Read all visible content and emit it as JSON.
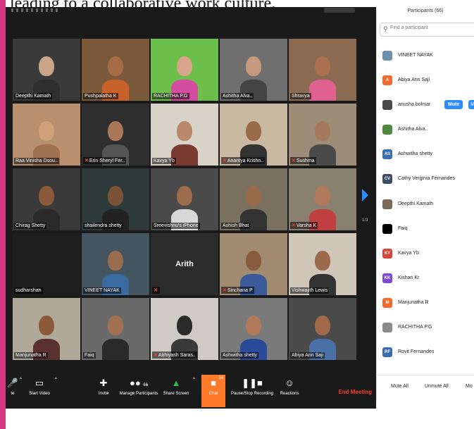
{
  "caption": "leading to a collaborative work culture.",
  "colors": {
    "accent": "#2d8cff",
    "chat": "#ff7a29",
    "end": "#ff3b30",
    "active_speaker": "#e5df5a",
    "pink_bar": "#d6387e"
  },
  "panel": {
    "title": "Participants (66)",
    "search_placeholder": "Find a participant",
    "participants": [
      {
        "name": "VINEET NAYAK",
        "avatar": "",
        "color": "#6d8fb0",
        "muted_button": false
      },
      {
        "name": "Abiya Ann Saji",
        "avatar": "A",
        "color": "#f26a2e",
        "muted_button": false
      },
      {
        "name": "anusha bolmar",
        "avatar": "",
        "color": "#4a4a4a",
        "muted_button": true,
        "mute_label": "Mute",
        "more_label": "M"
      },
      {
        "name": "Ashitha Alva..",
        "avatar": "",
        "color": "#4f8a3c",
        "muted_button": false
      },
      {
        "name": "Ashwitha shetty",
        "avatar": "AS",
        "color": "#3b6db2",
        "muted_button": false
      },
      {
        "name": "Cathy Verginia Fernandes",
        "avatar": "CV",
        "color": "#3e4c66",
        "muted_button": false
      },
      {
        "name": "Deepthi Kamath",
        "avatar": "",
        "color": "#7a6a5a",
        "muted_button": false
      },
      {
        "name": "Faiq",
        "avatar": "",
        "color": "#000000",
        "muted_button": false
      },
      {
        "name": "Kavya Yb",
        "avatar": "KY",
        "color": "#d9443a",
        "muted_button": false
      },
      {
        "name": "Kishan Kr",
        "avatar": "KK",
        "color": "#7b4bd1",
        "muted_button": false
      },
      {
        "name": "Manjunatha R",
        "avatar": "M",
        "color": "#f26a2e",
        "muted_button": false
      },
      {
        "name": "RACHITHA P.G",
        "avatar": "",
        "color": "#8a8a8a",
        "muted_button": false
      },
      {
        "name": "Rovit Fernandes",
        "avatar": "RF",
        "color": "#3b6db2",
        "muted_button": false
      }
    ],
    "mute_all": "Mute All",
    "unmute_all": "Unmute All",
    "more": "Mo"
  },
  "gallery": {
    "page_indicator": "1/3",
    "tiles": [
      {
        "name": "Deepthi Kamath",
        "muted": false,
        "bg": "#3a3a3a",
        "skin": "#c9a58a",
        "shirt": "#2f2f2f"
      },
      {
        "name": "Pushpalatha K",
        "muted": false,
        "bg": "#7a5a3a",
        "skin": "#a66c45",
        "shirt": "#c8612a",
        "active": true
      },
      {
        "name": "RACHITHA P.G",
        "muted": false,
        "bg": "#6cbf4a",
        "skin": "#d9a58a",
        "shirt": "#d54ca0"
      },
      {
        "name": "Ashitha Alva..",
        "muted": false,
        "bg": "#6f6f6f",
        "skin": "#c69a7c",
        "shirt": "#444"
      },
      {
        "name": "Shravya",
        "muted": false,
        "bg": "#8a6a50",
        "skin": "#a8704f",
        "shirt": "#e06090"
      },
      {
        "name": "Raa Vinisha Dsou..",
        "muted": false,
        "bg": "#b89070",
        "skin": "#d0a07a",
        "shirt": "#a07050"
      },
      {
        "name": "Erin Sheryl Fer..",
        "muted": true,
        "bg": "#2e2e2e",
        "skin": "#a87858",
        "shirt": "#555"
      },
      {
        "name": "Kavya Yb",
        "muted": false,
        "bg": "#d8d3c8",
        "skin": "#b9876a",
        "shirt": "#7a3a30"
      },
      {
        "name": "Anantya Krishn..",
        "muted": true,
        "bg": "#c9b9a3",
        "skin": "#9b6a4a",
        "shirt": "#333"
      },
      {
        "name": "Sushma",
        "muted": true,
        "bg": "#9d8d78",
        "skin": "#a57a5c",
        "shirt": "#4a4a4a"
      },
      {
        "name": "Chirag Shetty",
        "muted": false,
        "bg": "#3a3a3a",
        "skin": "#8a5a3a",
        "shirt": "#2a2a2a"
      },
      {
        "name": "shailendra shetty",
        "muted": false,
        "bg": "#2f3a3a",
        "skin": "#7a5236",
        "shirt": "#222"
      },
      {
        "name": "Sreevishnu's iPhone",
        "muted": false,
        "bg": "#4a4a4a",
        "skin": "#9c6c4c",
        "shirt": "#d8d8d8"
      },
      {
        "name": "Ashish Bhat",
        "muted": false,
        "bg": "#7a7060",
        "skin": "#9a6a48",
        "shirt": "#333"
      },
      {
        "name": "Varsha K",
        "muted": true,
        "bg": "#8a8070",
        "skin": "#b07a5a",
        "shirt": "#c04040"
      },
      {
        "name": "sudharshan",
        "muted": false,
        "bg": "#1e1e1e",
        "blank": true
      },
      {
        "name": "VINEET NAYAK",
        "muted": false,
        "bg": "#455560",
        "skin": "#9a6c4e",
        "shirt": "#3a6aa0"
      },
      {
        "name": "",
        "muted": true,
        "bg": "#2b2b2b",
        "blank": true,
        "center": "Arith"
      },
      {
        "name": "Sinchana P",
        "muted": true,
        "bg": "#a08a70",
        "skin": "#8a5c3e",
        "shirt": "#3a5a9a"
      },
      {
        "name": "Vishwajith Lewis",
        "muted": false,
        "bg": "#cfc6b8",
        "skin": "#9a6a4a",
        "shirt": "#333"
      },
      {
        "name": "Manjunatha R",
        "muted": false,
        "bg": "#b0a898",
        "skin": "#8a5a3a",
        "shirt": "#5a3030"
      },
      {
        "name": "Faiq",
        "muted": false,
        "bg": "#6a6a6a",
        "skin": "#a07050",
        "shirt": "#2a2a2a"
      },
      {
        "name": "Abhiyash Saras..",
        "muted": true,
        "bg": "#cfcac4",
        "skin": "#2a2a2a",
        "shirt": "#3a3a3a"
      },
      {
        "name": "Ashwitha shetty",
        "muted": false,
        "bg": "#7a7a7a",
        "skin": "#b07a5a",
        "shirt": "#2a4a9a"
      },
      {
        "name": "Abiya Ann Saji",
        "muted": false,
        "bg": "#4a4a4a",
        "skin": "#a06a4a",
        "shirt": "#4a70a8"
      }
    ]
  },
  "toolbar": {
    "mute_label": "te",
    "start_video_label": "Start Video",
    "invite_label": "Invite",
    "manage_participants_label": "Manage Participants",
    "participants_count": "66",
    "share_screen_label": "Share Screen",
    "chat_label": "Chat",
    "chat_badge": "14",
    "record_label": "Pause/Stop Recording",
    "reactions_label": "Reactions",
    "end_meeting_label": "End Meeting"
  }
}
